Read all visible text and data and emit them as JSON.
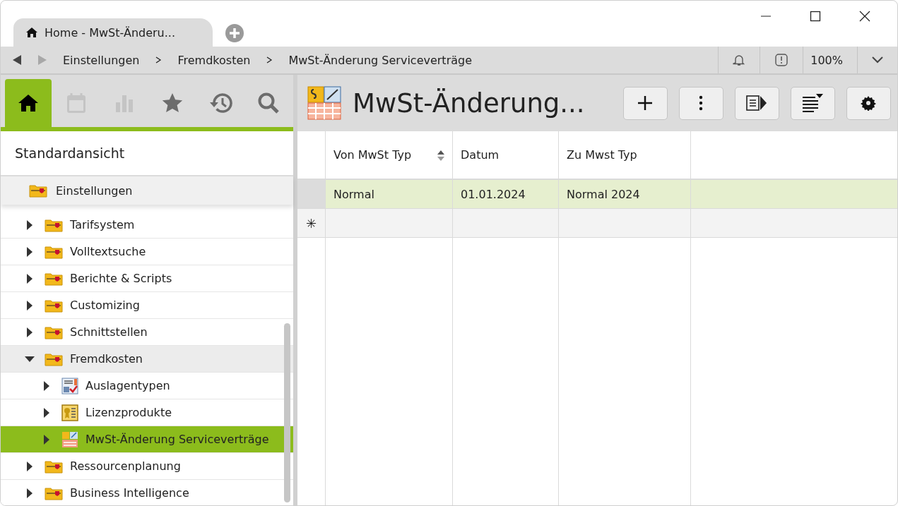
{
  "tabs": [
    {
      "label": "Home - MwSt-Änderu...",
      "selected": true
    }
  ],
  "breadcrumb": [
    "Einstellungen",
    "Fremdkosten",
    "MwSt-Änderung Serviceverträge"
  ],
  "zoom": "100%",
  "sidebar": {
    "tabs": [
      {
        "kind": "home",
        "selected": true,
        "disabled": false
      },
      {
        "kind": "calendar",
        "selected": false,
        "disabled": true
      },
      {
        "kind": "chart",
        "selected": false,
        "disabled": true
      },
      {
        "kind": "star",
        "selected": false,
        "disabled": false
      },
      {
        "kind": "history",
        "selected": false,
        "disabled": false
      },
      {
        "kind": "search",
        "selected": false,
        "disabled": false
      }
    ],
    "view": "Standardansicht",
    "pinned": "Einstellungen",
    "tree": [
      {
        "label": "Tarifsystem",
        "kind": "folder",
        "expanded": false,
        "selected": false
      },
      {
        "label": "Volltextsuche",
        "kind": "folder",
        "expanded": false,
        "selected": false
      },
      {
        "label": "Berichte & Scripts",
        "kind": "folder",
        "expanded": false,
        "selected": false
      },
      {
        "label": "Customizing",
        "kind": "folder",
        "expanded": false,
        "selected": false
      },
      {
        "label": "Schnittstellen",
        "kind": "folder",
        "expanded": false,
        "selected": false
      },
      {
        "label": "Fremdkosten",
        "kind": "folder",
        "expanded": true,
        "selected": false,
        "children": [
          {
            "label": "Auslagentypen",
            "kind": "form",
            "expanded": false,
            "selected": false
          },
          {
            "label": "Lizenzprodukte",
            "kind": "license",
            "expanded": false,
            "selected": false
          },
          {
            "label": "MwSt-Änderung Serviceverträge",
            "kind": "vat",
            "expanded": false,
            "selected": true
          }
        ]
      },
      {
        "label": "Ressourcenplanung",
        "kind": "folder",
        "expanded": false,
        "selected": false
      },
      {
        "label": "Business Intelligence",
        "kind": "folder",
        "expanded": false,
        "selected": false
      }
    ]
  },
  "page": {
    "title": "MwSt-Änderung...",
    "toolbar": [
      {
        "kind": "add"
      },
      {
        "kind": "more"
      },
      {
        "kind": "panel"
      },
      {
        "kind": "sort"
      },
      {
        "kind": "settings"
      }
    ]
  },
  "table": {
    "columns": [
      {
        "label": "Von MwSt Typ",
        "sortable": true
      },
      {
        "label": "Datum",
        "sortable": false
      },
      {
        "label": "Zu Mwst Typ",
        "sortable": false
      }
    ],
    "rows": [
      {
        "cells": [
          "Normal",
          "01.01.2024",
          "Normal 2024"
        ],
        "selected": true
      }
    ],
    "new_row_marker": "✳"
  }
}
